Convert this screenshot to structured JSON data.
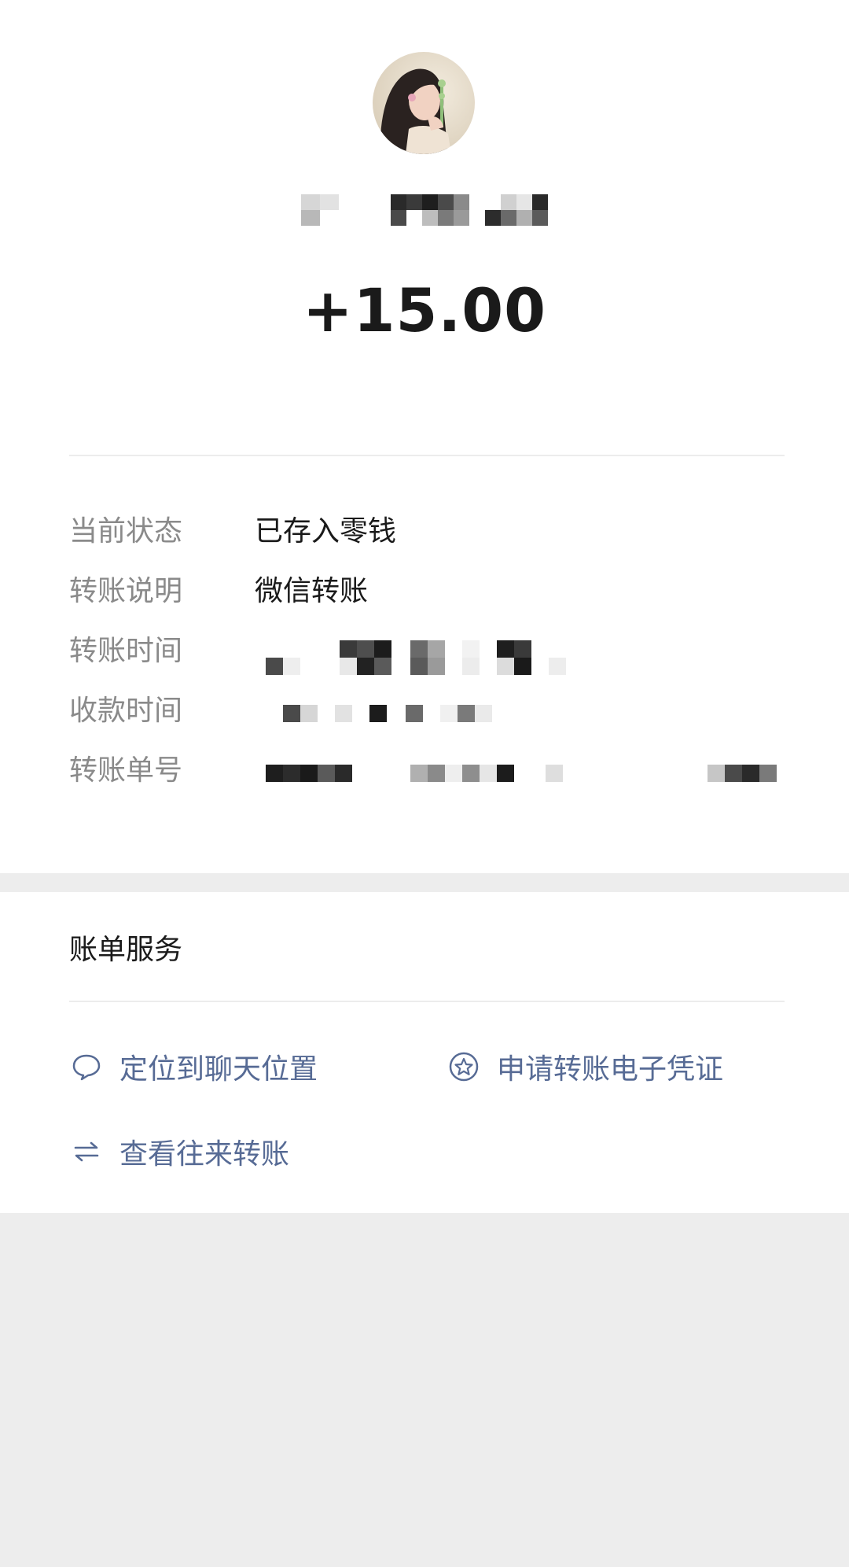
{
  "amount": "+15.00",
  "details": [
    {
      "label": "当前状态",
      "value": "已存入零钱"
    },
    {
      "label": "转账说明",
      "value": "微信转账"
    },
    {
      "label": "转账时间",
      "value": ""
    },
    {
      "label": "收款时间",
      "value": ""
    },
    {
      "label": "转账单号",
      "value": ""
    }
  ],
  "service": {
    "title": "账单服务",
    "links": [
      {
        "label": "定位到聊天位置",
        "icon": "chat-bubble-icon"
      },
      {
        "label": "申请转账电子凭证",
        "icon": "star-badge-icon"
      },
      {
        "label": "查看往来转账",
        "icon": "swap-arrows-icon"
      }
    ]
  },
  "colors": {
    "background": "#ededed",
    "card": "#ffffff",
    "label_gray": "#8a8a8a",
    "text_dark": "#1a1a1a",
    "link_blue": "#576b95"
  }
}
